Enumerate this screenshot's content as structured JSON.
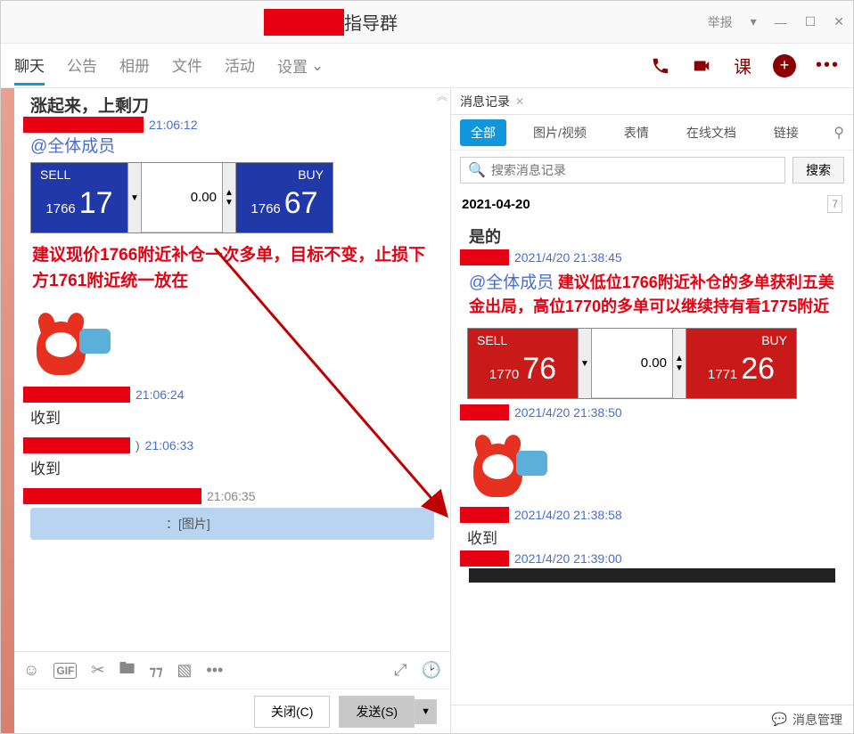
{
  "window": {
    "title_suffix": "指导群",
    "report": "举报"
  },
  "tabs": [
    "聊天",
    "公告",
    "相册",
    "文件",
    "活动"
  ],
  "settings_label": "设置",
  "course_label": "课",
  "left": {
    "header_msg": "涨起来，上剩刀",
    "ts1": "21:06:12",
    "mention": "@全体成员",
    "trade_blue": {
      "sell_label": "SELL",
      "buy_label": "BUY",
      "amount": "0.00",
      "sell_prefix": "1766",
      "sell_big": "17",
      "buy_prefix": "1766",
      "buy_big": "67"
    },
    "advice": "建议现价1766附近补仓一次多单，目标不变，止损下方1761附近统一放在",
    "ts2": "21:06:24",
    "reply1": "收到",
    "ts3": "21:06:33",
    "reply2": "收到",
    "ts4": "21:06:35",
    "img_tag": "：[图片]"
  },
  "buttons": {
    "close": "关闭(C)",
    "send": "发送(S)"
  },
  "right": {
    "panel_title": "消息记录",
    "filters": [
      "全部",
      "图片/视频",
      "表情",
      "在线文档",
      "链接"
    ],
    "search_placeholder": "搜索消息记录",
    "search_btn": "搜索",
    "date": "2021-04-20",
    "msg1": "是的",
    "ts1": "2021/4/20 21:38:45",
    "mention": "@全体成员",
    "advice": "建议低位1766附近补仓的多单获利五美金出局，高位1770的多单可以继续持有看1775附近",
    "trade_red": {
      "sell_label": "SELL",
      "buy_label": "BUY",
      "amount": "0.00",
      "sell_prefix": "1770",
      "sell_big": "76",
      "buy_prefix": "1771",
      "buy_big": "26"
    },
    "ts2": "2021/4/20 21:38:50",
    "ts3": "2021/4/20 21:38:58",
    "reply": "收到",
    "ts4": "2021/4/20 21:39:00",
    "footer": "消息管理"
  }
}
